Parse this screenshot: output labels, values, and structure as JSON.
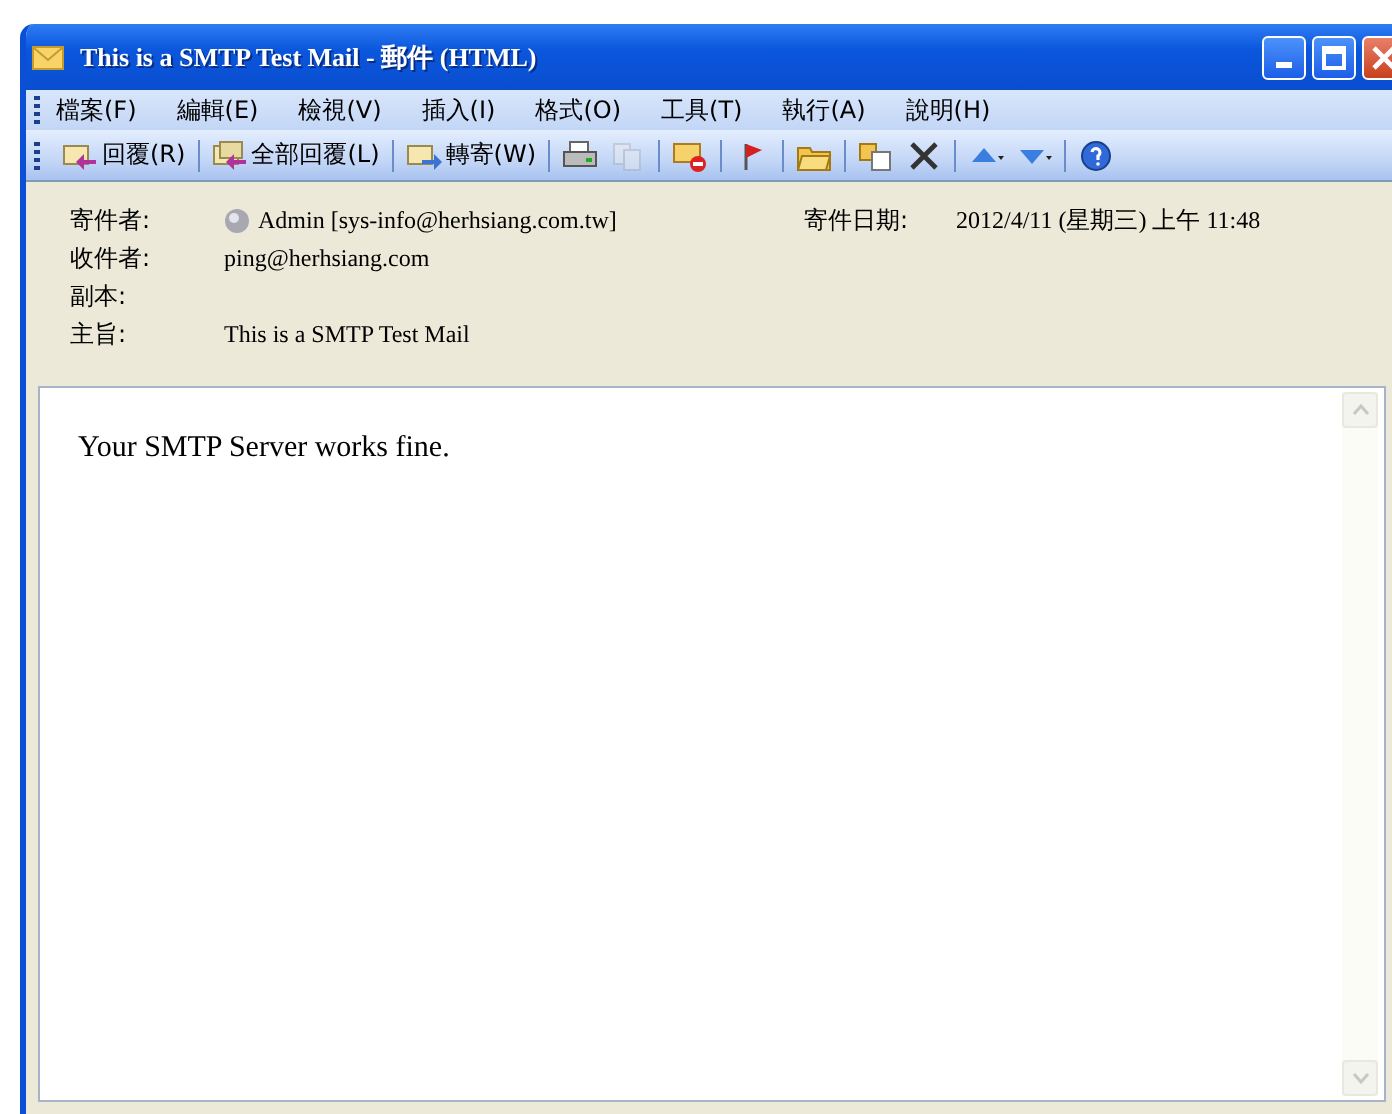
{
  "window": {
    "title": "This is a SMTP Test Mail - 郵件 (HTML)"
  },
  "menu": [
    "檔案(F)",
    "編輯(E)",
    "檢視(V)",
    "插入(I)",
    "格式(O)",
    "工具(T)",
    "執行(A)",
    "說明(H)"
  ],
  "toolbar": [
    {
      "kind": "reply",
      "label": "回覆(R)",
      "disabled": false
    },
    {
      "kind": "reply-all",
      "label": "全部回覆(L)",
      "disabled": false
    },
    {
      "kind": "forward",
      "label": "轉寄(W)",
      "disabled": false
    },
    {
      "kind": "print",
      "disabled": false
    },
    {
      "kind": "copy",
      "disabled": true
    },
    {
      "kind": "block",
      "disabled": false
    },
    {
      "kind": "flag",
      "disabled": false
    },
    {
      "kind": "folder",
      "disabled": false
    },
    {
      "kind": "move",
      "disabled": false
    },
    {
      "kind": "delete",
      "disabled": false
    },
    {
      "kind": "previous",
      "disabled": false
    },
    {
      "kind": "next",
      "disabled": false
    },
    {
      "kind": "help",
      "disabled": false
    }
  ],
  "header": {
    "from_label": "寄件者:",
    "from": "Admin [sys-info@herhsiang.com.tw]",
    "date_label": "寄件日期:",
    "date": "2012/4/11 (星期三) 上午 11:48",
    "to_label": "收件者:",
    "to": "ping@herhsiang.com",
    "cc_label": "副本:",
    "subject_label": "主旨:",
    "subject": "This is a SMTP Test Mail"
  },
  "body": "Your SMTP Server works fine."
}
